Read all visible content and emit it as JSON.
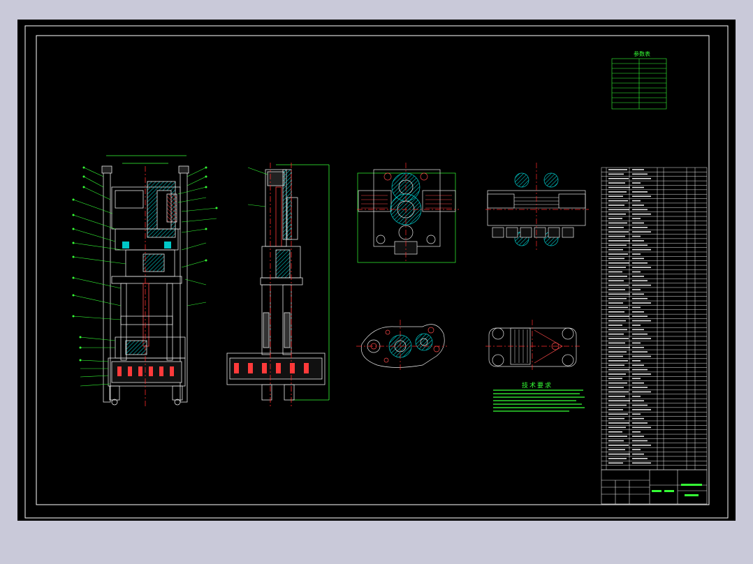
{
  "spec_table": {
    "title": "参数表"
  },
  "tech_requirements": {
    "title": "技术要求"
  },
  "colors": {
    "background": "#000000",
    "frame": "#ffffff",
    "annotation": "#35ff35",
    "hatch": "#00c8c8",
    "centerline": "#ff2a2a",
    "outline": "#e8e8e8",
    "viewport_border": "#c9c9d9"
  }
}
